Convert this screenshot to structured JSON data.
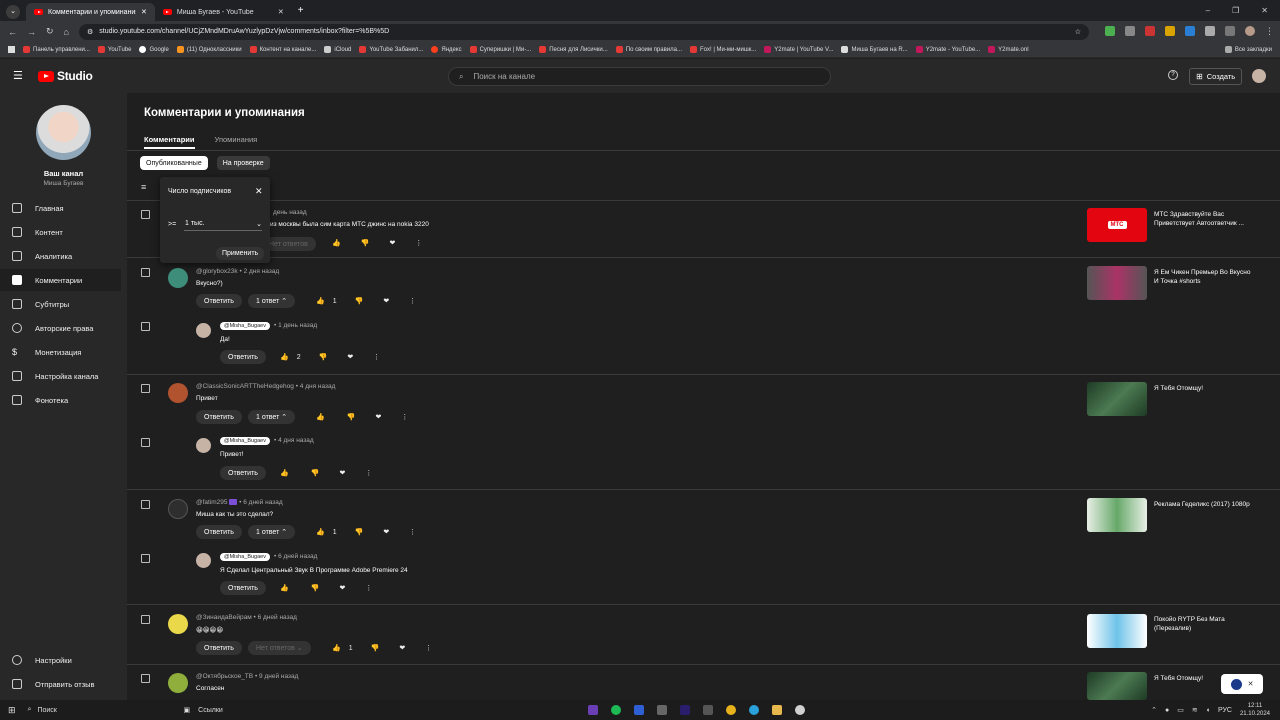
{
  "browser": {
    "tabs": [
      {
        "label": "Комментарии и упоминания",
        "close": "✕"
      },
      {
        "label": "Миша Бугаев - YouTube",
        "close": "✕"
      }
    ],
    "new_tab": "+",
    "url": "studio.youtube.com/channel/UCjZMndMDruAwYuzlypDzVjw/comments/inbox?filter=%5B%5D",
    "bookmarks": [
      "Панель управлени...",
      "YouTube",
      "Google",
      "(11) Одноклассники",
      "Контент на канале...",
      "iCloud",
      "YouTube Забанил...",
      "Яндекс",
      "Суперишки | Ми-...",
      "Песня для Лисички...",
      "По своим правила...",
      "Fox! | Ми-ми-мишк...",
      "Y2mate | YouTube V...",
      "Миша Бугаев на R...",
      "Y2mate - YouTube...",
      "Y2mate.onl"
    ],
    "all_bookmarks": "Все закладки"
  },
  "header": {
    "logo": "Studio",
    "search_placeholder": "Поиск на канале",
    "create": "Создать"
  },
  "sidebar": {
    "channel_title": "Ваш канал",
    "channel_name": "Миша Бугаев",
    "items": [
      {
        "label": "Главная",
        "icon": "dashboard-icon"
      },
      {
        "label": "Контент",
        "icon": "content-icon"
      },
      {
        "label": "Аналитика",
        "icon": "analytics-icon"
      },
      {
        "label": "Комментарии",
        "icon": "comments-icon",
        "active": true
      },
      {
        "label": "Субтитры",
        "icon": "subtitles-icon"
      },
      {
        "label": "Авторские права",
        "icon": "copyright-icon"
      },
      {
        "label": "Монетизация",
        "icon": "monetization-icon"
      },
      {
        "label": "Настройка канала",
        "icon": "customization-icon"
      },
      {
        "label": "Фонотека",
        "icon": "audio-library-icon"
      }
    ],
    "settings": "Настройки",
    "feedback": "Отправить отзыв"
  },
  "page": {
    "title": "Комментарии и упоминания",
    "tabs": [
      "Комментарии",
      "Упоминания"
    ],
    "chips": [
      "Опубликованные",
      "На проверке"
    ]
  },
  "filter_popup": {
    "title": "Число подписчиков",
    "op": ">=",
    "value": "1 тыс.",
    "apply": "Применить"
  },
  "comments": [
    {
      "author": "",
      "time": "день назад",
      "text": "из москвы была сим карта МТС джинс на nokia 3220",
      "reply": "Ответить",
      "replies": "Нет ответов",
      "likes": "",
      "video": {
        "title": "МТС Здравствуйте Вас Приветствует Автоответчик ...",
        "thumb_label": "МТС"
      }
    },
    {
      "author": "@glorybox23k",
      "time": "2 дня назад",
      "text": "Вкусно?)",
      "reply": "Ответить",
      "replies": "1 ответ",
      "likes": "1",
      "video": {
        "title": "Я Ем Чикен Премьер Во Вкусно И Точка #shorts"
      },
      "child": {
        "author": "@Misha_Bugaev",
        "time": "1 день назад",
        "text": "Да!",
        "reply": "Ответить",
        "likes": "2"
      }
    },
    {
      "author": "@ClassicSonicARTTheHedgehog",
      "time": "4 дня назад",
      "text": "Привет",
      "reply": "Ответить",
      "replies": "1 ответ",
      "likes": "",
      "video": {
        "title": "Я Тебя Отомщу!"
      },
      "child": {
        "author": "@Misha_Bugaev",
        "time": "4 дня назад",
        "text": "Привет!",
        "reply": "Ответить",
        "likes": ""
      }
    },
    {
      "author": "@fatim295",
      "time": "6 дней назад",
      "text": "Миша как ты это сделал?",
      "reply": "Ответить",
      "replies": "1 ответ",
      "likes": "1",
      "video": {
        "title": "Реклама Геделикс (2017) 1080p"
      },
      "child": {
        "author": "@Misha_Bugaev",
        "time": "6 дней назад",
        "text": "Я Сделал Центральный Звук В Программе Adobe Premiere 24",
        "reply": "Ответить",
        "likes": ""
      }
    },
    {
      "author": "@ЗинаидаВейрам",
      "time": "6 дней назад",
      "text": "😀😀😀😀",
      "reply": "Ответить",
      "replies": "Нет ответов",
      "likes": "1",
      "video": {
        "title": "Покойо RYTP Без Мата (Перезалив)"
      }
    },
    {
      "author": "@Октябрьское_ТВ",
      "time": "9 дней назад",
      "text": "Согласен",
      "video": {
        "title": "Я Тебя Отомщу!"
      }
    }
  ],
  "separator": "•",
  "taskbar": {
    "search": "Поиск",
    "links": "Ссылки",
    "lang": "РУС",
    "time": "12:11",
    "date": "21.10.2024"
  }
}
